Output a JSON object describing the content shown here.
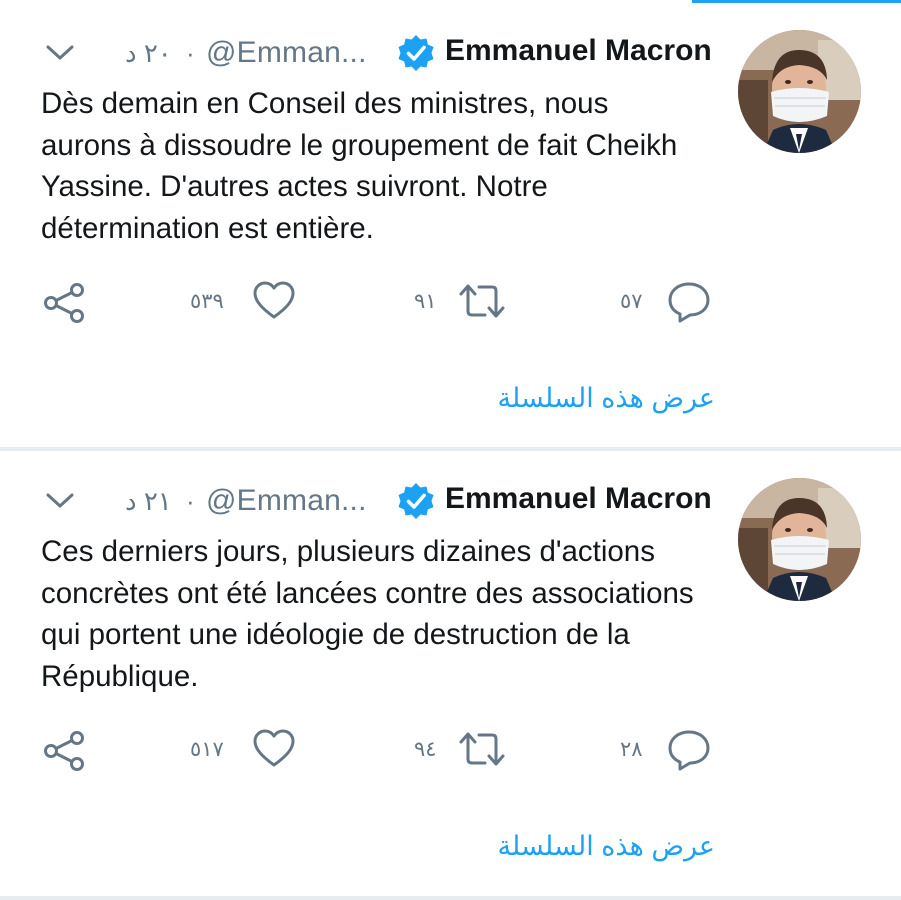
{
  "colors": {
    "accent": "#1da1f2",
    "text": "#14171a",
    "secondary": "#657786",
    "separator": "#e6ecf0"
  },
  "tweets": [
    {
      "author_name": "Emmanuel Macron",
      "handle": "@Emman...",
      "time": "٢٠ د",
      "separator_dot": "·",
      "verified_icon": "verified-badge-icon",
      "text": "Dès demain en Conseil des ministres, nous aurons à dissoudre le groupement de fait Cheikh Yassine. D'autres actes suivront. Notre détermination est entière.",
      "likes": "٥٣٩",
      "retweets": "٩١",
      "replies": "٥٧",
      "show_thread": "عرض هذه السلسلة"
    },
    {
      "author_name": "Emmanuel Macron",
      "handle": "@Emman...",
      "time": "٢١ د",
      "separator_dot": "·",
      "verified_icon": "verified-badge-icon",
      "text": "Ces derniers jours, plusieurs dizaines d'actions concrètes ont été lancées contre des associations qui portent une idéologie de destruction de la République.",
      "likes": "٥١٧",
      "retweets": "٩٤",
      "replies": "٢٨",
      "show_thread": "عرض هذه السلسلة"
    }
  ]
}
